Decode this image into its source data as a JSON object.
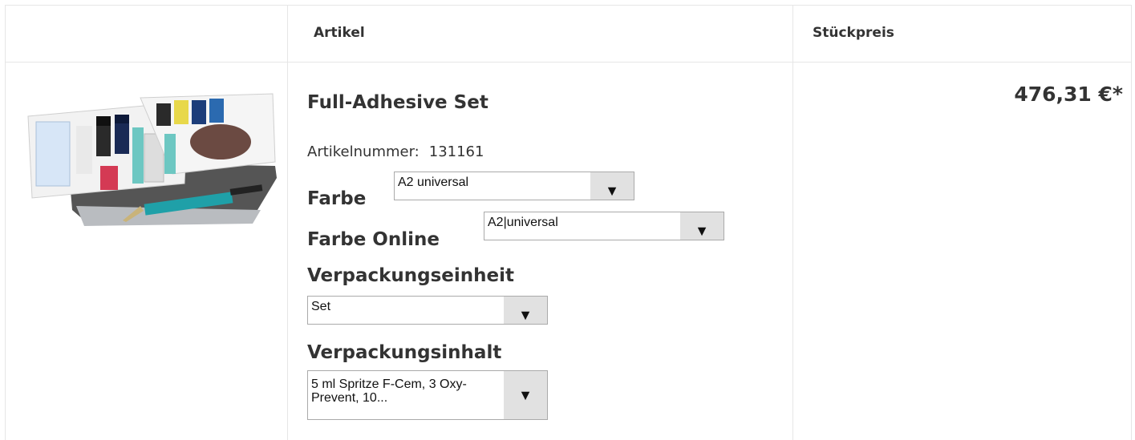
{
  "table": {
    "headers": {
      "article": "Artikel",
      "unit_price": "Stückpreis"
    }
  },
  "product": {
    "image_icon": "dental-adhesive-set-image",
    "name": "Full-Adhesive Set",
    "article_number_label": "Artikelnummer:",
    "article_number": "131161",
    "price": "476,31 €*",
    "options": {
      "color": {
        "label": "Farbe",
        "value": "A2 universal"
      },
      "color_online": {
        "label": "Farbe Online",
        "value": "A2|universal"
      },
      "packaging_unit": {
        "label": "Verpackungseinheit",
        "value": "Set"
      },
      "packaging_content": {
        "label": "Verpackungsinhalt",
        "value": "5 ml Spritze F-Cem, 3 Oxy-Prevent, 10..."
      }
    }
  },
  "icons": {
    "dropdown": "triangle-down-icon"
  }
}
